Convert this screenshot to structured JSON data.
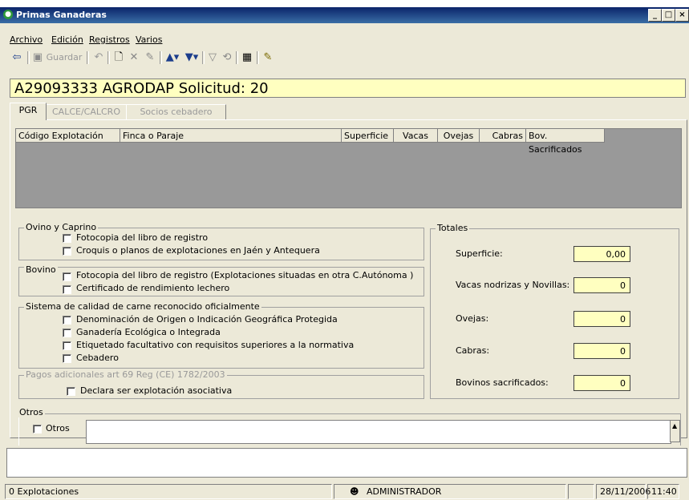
{
  "window": {
    "title": "Primas Ganaderas",
    "min": "_",
    "max": "□",
    "close": "×"
  },
  "menu": {
    "items": [
      "Archivo",
      "Edición",
      "Registros",
      "Varios"
    ]
  },
  "toolbar": {
    "save_label": "Guardar"
  },
  "header": {
    "text": "A29093333  AGRODAP  Solicitud: 20"
  },
  "tabs": [
    "PGR",
    "CALCE/CALCRO",
    "Socios cebadero"
  ],
  "grid": {
    "columns": [
      "Código Explotación",
      "Finca o Paraje",
      "Superficie",
      "Vacas",
      "Ovejas",
      "Cabras",
      "Bov. Sacrificados"
    ]
  },
  "ovino": {
    "title": "Ovino y Caprino",
    "items": [
      "Fotocopia del libro de registro",
      "Croquis o planos de explotaciones en Jaén y Antequera"
    ]
  },
  "bovino": {
    "title": "Bovino",
    "items": [
      "Fotocopia del libro de registro (Explotaciones situadas en otra C.Autónoma )",
      "Certificado de rendimiento lechero"
    ]
  },
  "calidad": {
    "title": "Sistema de calidad de carne reconocido oficialmente",
    "items": [
      "Denominación de Origen o Indicación Geográfica Protegida",
      "Ganadería Ecológica o Integrada",
      "Etiquetado facultativo con requisitos superiores a la normativa",
      "Cebadero"
    ]
  },
  "pagos": {
    "title": "Pagos adicionales art 69 Reg (CE) 1782/2003",
    "items": [
      "Declara ser explotación asociativa"
    ]
  },
  "totales": {
    "title": "Totales",
    "rows": [
      {
        "label": "Superficie:",
        "value": "0,00"
      },
      {
        "label": "Vacas nodrizas y Novillas:",
        "value": "0"
      },
      {
        "label": "Ovejas:",
        "value": "0"
      },
      {
        "label": "Cabras:",
        "value": "0"
      },
      {
        "label": "Bovinos sacrificados:",
        "value": "0"
      }
    ]
  },
  "otros": {
    "title": "Otros",
    "checkbox_label": "Otros"
  },
  "status": {
    "count": "0 Explotaciones",
    "user": "ADMINISTRADOR",
    "date": "28/11/2006",
    "time": "11:40"
  }
}
